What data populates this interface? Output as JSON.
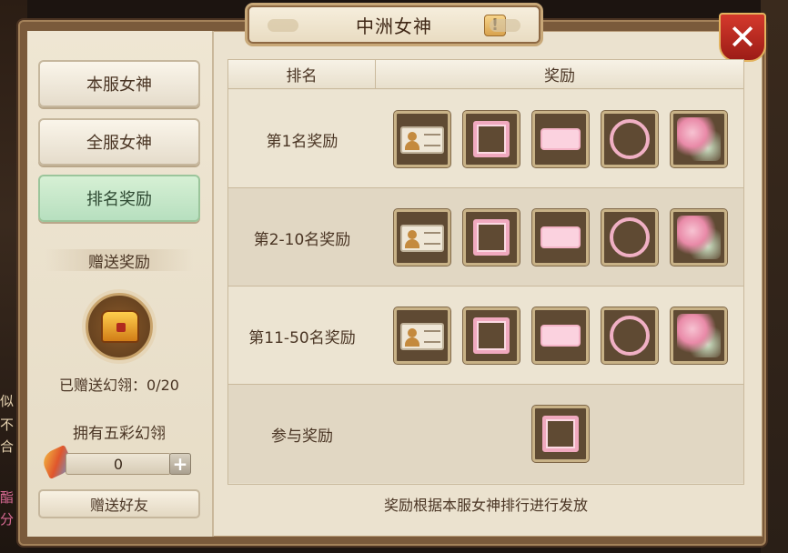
{
  "window": {
    "title": "中洲女神"
  },
  "side_text": {
    "left_bottom_chars": [
      "似",
      "不",
      "合"
    ],
    "left_pink_chars": [
      "酯",
      "分"
    ]
  },
  "tabs": [
    {
      "label": "本服女神",
      "active": false
    },
    {
      "label": "全服女神",
      "active": false
    },
    {
      "label": "排名奖励",
      "active": true
    }
  ],
  "gift": {
    "section_title": "赠送奖励",
    "gifted_label": "已赠送幻翎：0/20",
    "own_label": "拥有五彩幻翎",
    "quantity": "0",
    "gift_button": "赠送好友"
  },
  "table": {
    "header_rank": "排名",
    "header_reward": "奖励",
    "rows": [
      {
        "rank": "第1名奖励",
        "items": [
          "name-card-icon",
          "pink-frame-icon",
          "pink-bubble-icon",
          "flower-ring-icon",
          "flower-corner-icon"
        ]
      },
      {
        "rank": "第2-10名奖励",
        "items": [
          "name-card-icon",
          "pink-frame-icon",
          "pink-bubble-icon",
          "flower-ring-icon",
          "flower-corner-icon"
        ]
      },
      {
        "rank": "第11-50名奖励",
        "items": [
          "name-card-icon",
          "pink-frame-icon",
          "pink-bubble-icon",
          "flower-ring-icon",
          "flower-corner-icon"
        ]
      },
      {
        "rank": "参与奖励",
        "items": [
          "pink-frame-icon"
        ]
      }
    ]
  },
  "footer_note": "奖励根据本服女神排行进行发放",
  "colors": {
    "accent_red": "#b0231b",
    "active_tab": "#c7e8c8",
    "panel": "#ebe2cf"
  }
}
